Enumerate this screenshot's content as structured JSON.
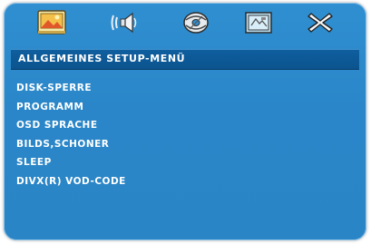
{
  "toolbar": {
    "icons": [
      "general-setup-icon",
      "audio-setup-icon",
      "video-setup-icon",
      "preference-setup-icon",
      "exit-icon"
    ]
  },
  "header": {
    "title": "ALLGEMEINES SETUP-MENÜ"
  },
  "menu": {
    "items": [
      {
        "label": "DISK-SPERRE"
      },
      {
        "label": "PROGRAMM"
      },
      {
        "label": "OSD SPRACHE"
      },
      {
        "label": "BILDS,SCHONER"
      },
      {
        "label": "SLEEP"
      },
      {
        "label": "DIVX(R) VOD-CODE"
      }
    ]
  },
  "colors": {
    "background": "#2a86c8",
    "title_bar": "#0b548f",
    "text": "#ffffff"
  }
}
